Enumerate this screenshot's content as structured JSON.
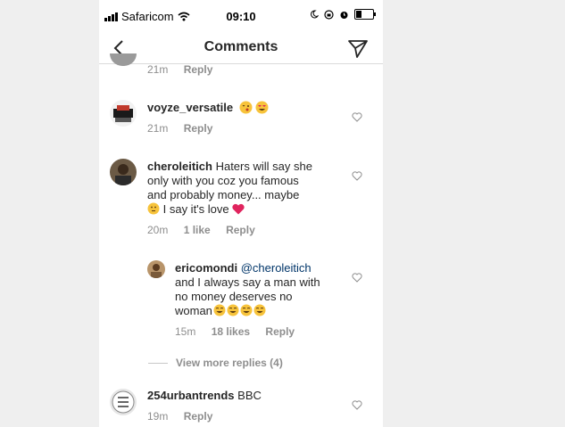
{
  "status_bar": {
    "carrier": "Safaricom",
    "time": "09:10"
  },
  "header": {
    "title": "Comments"
  },
  "comments": [
    {
      "time": "21m",
      "reply": "Reply"
    },
    {
      "username": "voyze_versatile",
      "time": "21m",
      "reply": "Reply"
    },
    {
      "username": "cheroleitich",
      "text_1": " Haters will say she",
      "text_2": "only with you coz you famous",
      "text_3": "and probably money... maybe",
      "text_4": " I say it's love ",
      "time": "20m",
      "likes": "1 like",
      "reply": "Reply"
    },
    {
      "username": "ericomondi",
      "mention": "@cheroleitich",
      "text_2": "and I always say a man with",
      "text_3": "no money deserves no",
      "text_4": "woman",
      "time": "15m",
      "likes": "18 likes",
      "reply": "Reply"
    },
    {
      "username": "254urbantrends",
      "text": " BBC",
      "time": "19m",
      "reply": "Reply"
    }
  ],
  "view_more": "View more replies (4)",
  "icons": {
    "back": "chevron-left-icon",
    "send": "paper-plane-icon",
    "like": "heart-outline-icon"
  }
}
